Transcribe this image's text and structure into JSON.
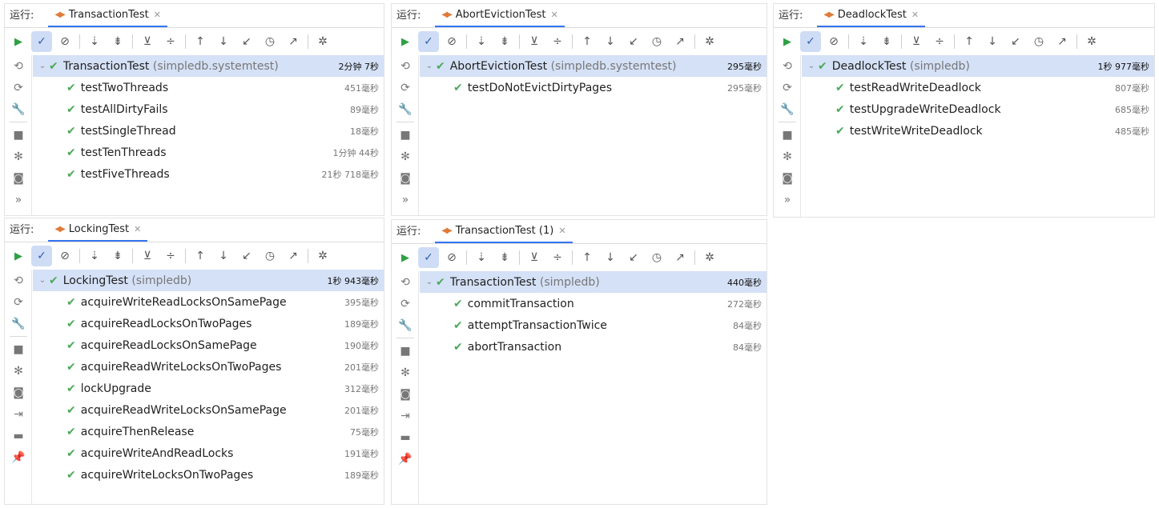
{
  "colors": {
    "accent": "#3574f0",
    "check": "#4caa5a",
    "selection": "#d5e1f6",
    "run_icon": "#2fa045"
  },
  "panels": [
    {
      "run_label": "运行:",
      "tab_title": "TransactionTest",
      "root": {
        "name": "TransactionTest",
        "package": "(simpledb.systemtest)",
        "duration": "2分钟 7秒"
      },
      "tests": [
        {
          "name": "testTwoThreads",
          "duration": "451毫秒"
        },
        {
          "name": "testAllDirtyFails",
          "duration": "89毫秒"
        },
        {
          "name": "testSingleThread",
          "duration": "18毫秒"
        },
        {
          "name": "testTenThreads",
          "duration": "1分钟 44秒"
        },
        {
          "name": "testFiveThreads",
          "duration": "21秒 718毫秒"
        }
      ]
    },
    {
      "run_label": "运行:",
      "tab_title": "AbortEvictionTest",
      "root": {
        "name": "AbortEvictionTest",
        "package": "(simpledb.systemtest)",
        "duration": "295毫秒"
      },
      "tests": [
        {
          "name": "testDoNotEvictDirtyPages",
          "duration": "295毫秒"
        }
      ]
    },
    {
      "run_label": "运行:",
      "tab_title": "DeadlockTest",
      "root": {
        "name": "DeadlockTest",
        "package": "(simpledb)",
        "duration": "1秒 977毫秒"
      },
      "tests": [
        {
          "name": "testReadWriteDeadlock",
          "duration": "807毫秒"
        },
        {
          "name": "testUpgradeWriteDeadlock",
          "duration": "685毫秒"
        },
        {
          "name": "testWriteWriteDeadlock",
          "duration": "485毫秒"
        }
      ]
    },
    {
      "run_label": "运行:",
      "tab_title": "LockingTest",
      "root": {
        "name": "LockingTest",
        "package": "(simpledb)",
        "duration": "1秒 943毫秒"
      },
      "tests": [
        {
          "name": "acquireWriteReadLocksOnSamePage",
          "duration": "395毫秒"
        },
        {
          "name": "acquireReadLocksOnTwoPages",
          "duration": "189毫秒"
        },
        {
          "name": "acquireReadLocksOnSamePage",
          "duration": "190毫秒"
        },
        {
          "name": "acquireReadWriteLocksOnTwoPages",
          "duration": "201毫秒"
        },
        {
          "name": "lockUpgrade",
          "duration": "312毫秒"
        },
        {
          "name": "acquireReadWriteLocksOnSamePage",
          "duration": "201毫秒"
        },
        {
          "name": "acquireThenRelease",
          "duration": "75毫秒"
        },
        {
          "name": "acquireWriteAndReadLocks",
          "duration": "191毫秒"
        },
        {
          "name": "acquireWriteLocksOnTwoPages",
          "duration": "189毫秒"
        }
      ]
    },
    {
      "run_label": "运行:",
      "tab_title": "TransactionTest (1)",
      "root": {
        "name": "TransactionTest",
        "package": "(simpledb)",
        "duration": "440毫秒"
      },
      "tests": [
        {
          "name": "commitTransaction",
          "duration": "272毫秒"
        },
        {
          "name": "attemptTransactionTwice",
          "duration": "84毫秒"
        },
        {
          "name": "abortTransaction",
          "duration": "84毫秒"
        }
      ]
    }
  ]
}
